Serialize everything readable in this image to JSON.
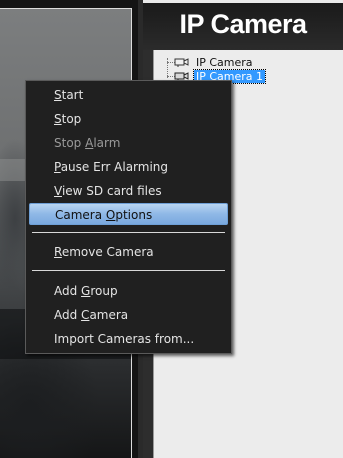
{
  "panel": {
    "title": "IP Camera"
  },
  "tree": {
    "items": [
      {
        "label": "IP Camera",
        "icon": "camera-group-icon",
        "selected": false
      },
      {
        "label": "IP Camera 1",
        "icon": "camera-icon",
        "selected": true
      }
    ]
  },
  "context_menu": {
    "items": [
      {
        "pre": "",
        "acc": "S",
        "post": "tart"
      },
      {
        "pre": "",
        "acc": "S",
        "post": "top"
      },
      {
        "pre": "Stop ",
        "acc": "A",
        "post": "larm"
      },
      {
        "pre": "",
        "acc": "P",
        "post": "ause Err Alarming"
      },
      {
        "pre": "",
        "acc": "V",
        "post": "iew SD card files"
      },
      {
        "pre": "Camera ",
        "acc": "O",
        "post": "ptions"
      },
      {
        "pre": "",
        "acc": "R",
        "post": "emove Camera"
      },
      {
        "pre": "Add ",
        "acc": "G",
        "post": "roup"
      },
      {
        "pre": "Add ",
        "acc": "C",
        "post": "amera"
      },
      {
        "pre": "Import Cameras from...",
        "acc": "",
        "post": ""
      }
    ]
  },
  "colors": {
    "menu_background": "#202020",
    "highlight": "#8fb8e6",
    "selection": "#3399ff"
  }
}
